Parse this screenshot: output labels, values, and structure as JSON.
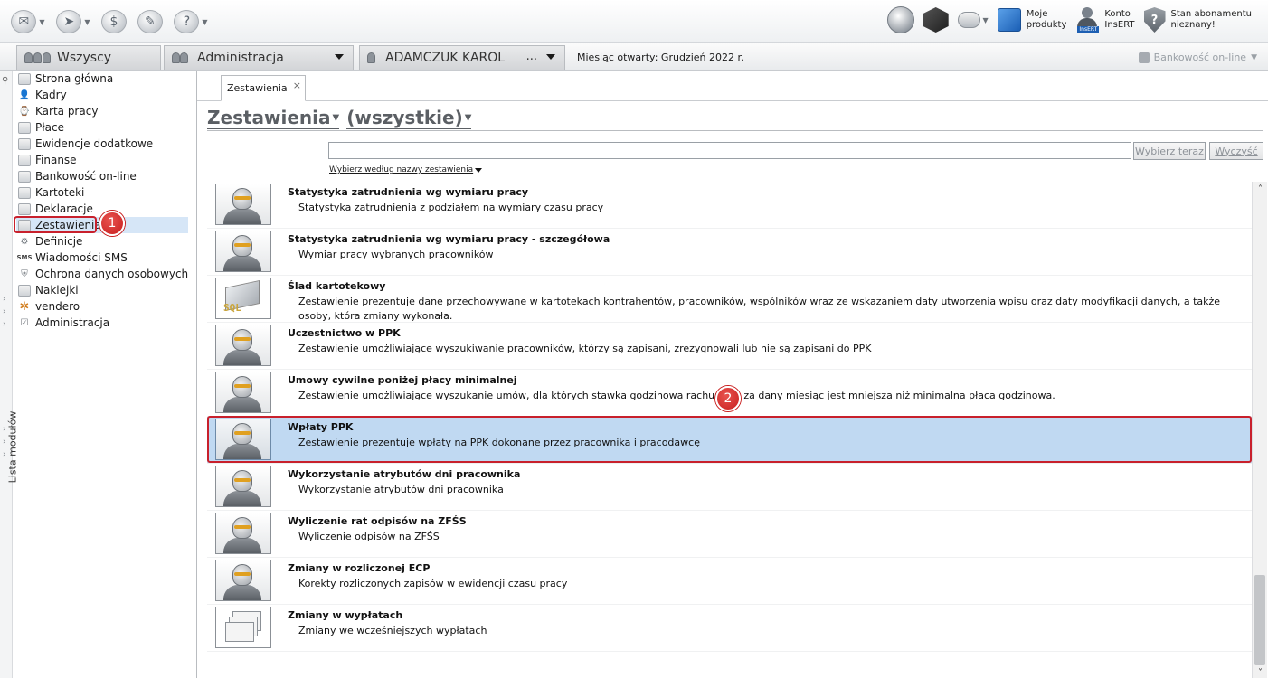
{
  "toolbar": {
    "moje_produkty": "Moje produkty",
    "moje_produkty_l1": "Moje",
    "moje_produkty_l2": "produkty",
    "konto_l1": "Konto",
    "konto_l2": "InsERT",
    "konto_tag": "InsERT",
    "abon_l1": "Stan abonamentu",
    "abon_l2": "nieznany!",
    "abon_mark": "?"
  },
  "context": {
    "tab_all": "Wszyscy",
    "tab_admin": "Administracja",
    "tab_user": "ADAMCZUK KAROL",
    "tab_user_more": "...",
    "month_label": "Miesiąc otwarty:",
    "month_value": "Grudzień 2022 r.",
    "bank": "Bankowość on-line"
  },
  "sidebar": {
    "strip_label": "Lista modułów",
    "items": [
      {
        "label": "Strona główna"
      },
      {
        "label": "Kadry"
      },
      {
        "label": "Karta pracy"
      },
      {
        "label": "Płace"
      },
      {
        "label": "Ewidencje dodatkowe"
      },
      {
        "label": "Finanse"
      },
      {
        "label": "Bankowość on-line"
      },
      {
        "label": "Kartoteki"
      },
      {
        "label": "Deklaracje"
      },
      {
        "label": "Zestawienia"
      },
      {
        "label": "Definicje"
      },
      {
        "label": "Wiadomości SMS"
      },
      {
        "label": "Ochrona danych osobowych"
      },
      {
        "label": "Naklejki"
      },
      {
        "label": "vendero"
      },
      {
        "label": "Administracja"
      }
    ],
    "sms_tag": "SMS"
  },
  "main": {
    "doc_tab": "Zestawienia",
    "doc_tab_close": "×",
    "heading": "Zestawienia",
    "filter": "(wszystkie)",
    "search_value": "",
    "btn_choose": "Wybierz teraz",
    "btn_clear": "Wyczyść",
    "choose_by": "Wybierz według nazwy zestawienia",
    "reports": [
      {
        "title": "Statystyka zatrudnienia wg wymiaru pracy",
        "desc": "Statystyka zatrudnienia z podziałem na wymiary czasu pracy"
      },
      {
        "title": "Statystyka zatrudnienia wg wymiaru pracy - szczegółowa",
        "desc": "Wymiar pracy wybranych pracowników"
      },
      {
        "title": "Ślad kartotekowy",
        "desc": "Zestawienie prezentuje dane przechowywane w kartotekach kontrahentów, pracowników, wspólników wraz ze wskazaniem daty utworzenia wpisu oraz daty modyfikacji danych, a także osoby, która zmiany wykonała."
      },
      {
        "title": "Uczestnictwo w PPK",
        "desc": "Zestawienie umożliwiające wyszukiwanie pracowników, którzy są zapisani, zrezygnowali lub nie są zapisani do PPK"
      },
      {
        "title": "Umowy cywilne poniżej płacy minimalnej",
        "desc": "Zestawienie umożliwiające wyszukanie umów, dla których stawka godzinowa rachunków za dany miesiąc jest mniejsza niż minimalna płaca godzinowa."
      },
      {
        "title": "Wpłaty PPK",
        "desc": "Zestawienie prezentuje wpłaty na PPK dokonane przez pracownika i pracodawcę"
      },
      {
        "title": "Wykorzystanie atrybutów dni pracownika",
        "desc": "Wykorzystanie atrybutów dni pracownika"
      },
      {
        "title": "Wyliczenie rat odpisów na ZFŚS",
        "desc": "Wyliczenie odpisów na ZFŚS"
      },
      {
        "title": "Zmiany w rozliczonej ECP",
        "desc": "Korekty rozliczonych zapisów w ewidencji czasu pracy"
      },
      {
        "title": "Zmiany w wypłatach",
        "desc": "Zmiany we wcześniejszych wypłatach"
      }
    ],
    "sql_tag": "SQL"
  },
  "callouts": {
    "one": "1",
    "two": "2"
  },
  "colors": {
    "selection": "#c0d9f2",
    "callout_red": "#c81e1e",
    "heading_grey": "#5b5f64"
  }
}
